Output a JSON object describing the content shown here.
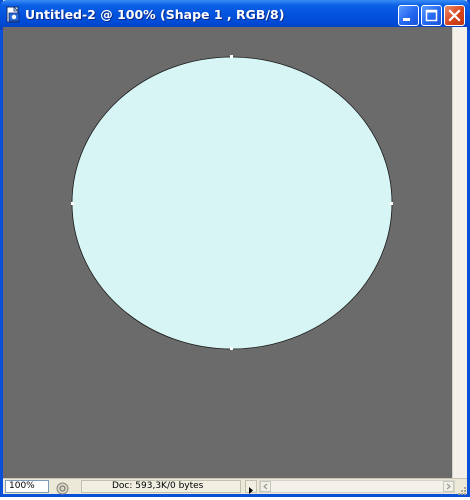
{
  "window": {
    "title": "Untitled-2 @ 100% (Shape 1 , RGB/8)",
    "controls": [
      "minimize-icon",
      "maximize-icon",
      "close-icon"
    ]
  },
  "canvas": {
    "background_color": "#6b6b6b",
    "shape": {
      "type": "ellipse",
      "fill_color": "#d6f5f4",
      "stroke_color": "#1a1a1a"
    }
  },
  "statusbar": {
    "zoom": "100%",
    "doc_info": "Doc: 593,3K/0 bytes"
  },
  "colors": {
    "titlebar": "#0353dd",
    "frame": "#0a4fd8",
    "close_button": "#d6441c"
  }
}
